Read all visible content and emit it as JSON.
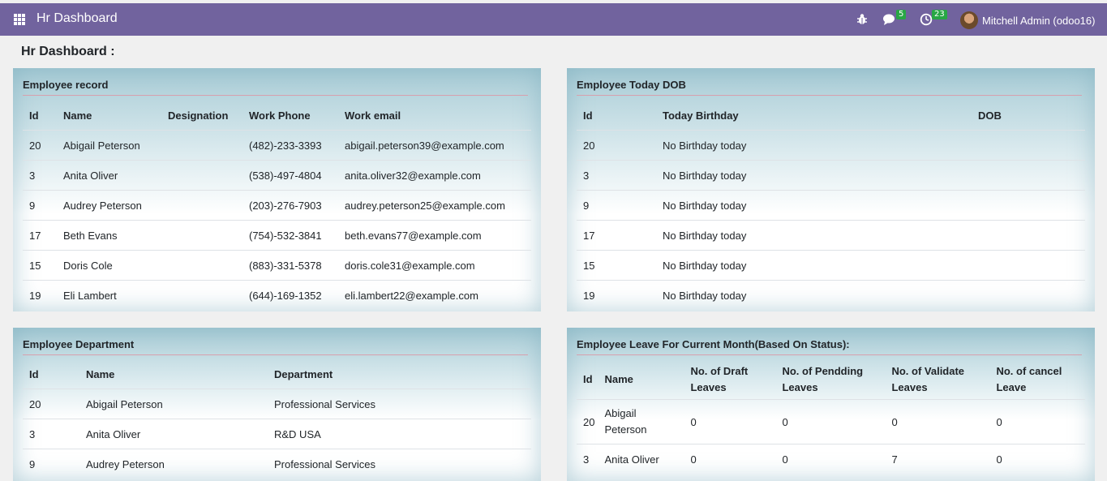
{
  "topbar": {
    "app_title": "Hr Dashboard",
    "chat_count": "5",
    "activity_count": "23",
    "user_name": "Mitchell Admin (odoo16)"
  },
  "page_title": "Hr Dashboard :",
  "employee_record": {
    "title": "Employee record",
    "headers": [
      "Id",
      "Name",
      "Designation",
      "Work Phone",
      "Work email"
    ],
    "rows": [
      [
        "20",
        "Abigail Peterson",
        "",
        "(482)-233-3393",
        "abigail.peterson39@example.com"
      ],
      [
        "3",
        "Anita Oliver",
        "",
        "(538)-497-4804",
        "anita.oliver32@example.com"
      ],
      [
        "9",
        "Audrey Peterson",
        "",
        "(203)-276-7903",
        "audrey.peterson25@example.com"
      ],
      [
        "17",
        "Beth Evans",
        "",
        "(754)-532-3841",
        "beth.evans77@example.com"
      ],
      [
        "15",
        "Doris Cole",
        "",
        "(883)-331-5378",
        "doris.cole31@example.com"
      ],
      [
        "19",
        "Eli Lambert",
        "",
        "(644)-169-1352",
        "eli.lambert22@example.com"
      ]
    ]
  },
  "employee_dob": {
    "title": "Employee Today DOB",
    "headers": [
      "Id",
      "Today Birthday",
      "DOB"
    ],
    "rows": [
      [
        "20",
        "No Birthday today",
        ""
      ],
      [
        "3",
        "No Birthday today",
        ""
      ],
      [
        "9",
        "No Birthday today",
        ""
      ],
      [
        "17",
        "No Birthday today",
        ""
      ],
      [
        "15",
        "No Birthday today",
        ""
      ],
      [
        "19",
        "No Birthday today",
        ""
      ]
    ]
  },
  "employee_department": {
    "title": "Employee Department",
    "headers": [
      "Id",
      "Name",
      "Department"
    ],
    "rows": [
      [
        "20",
        "Abigail Peterson",
        "Professional Services"
      ],
      [
        "3",
        "Anita Oliver",
        "R&D USA"
      ],
      [
        "9",
        "Audrey Peterson",
        "Professional Services"
      ]
    ]
  },
  "employee_leave": {
    "title": "Employee Leave For Current Month(Based On Status):",
    "headers": [
      "Id",
      "Name",
      "No. of Draft Leaves",
      "No. of Pendding Leaves",
      "No. of Validate Leaves",
      "No. of cancel Leave"
    ],
    "rows": [
      [
        "20",
        "Abigail Peterson",
        "0",
        "0",
        "0",
        "0"
      ],
      [
        "3",
        "Anita Oliver",
        "0",
        "0",
        "7",
        "0"
      ]
    ]
  }
}
